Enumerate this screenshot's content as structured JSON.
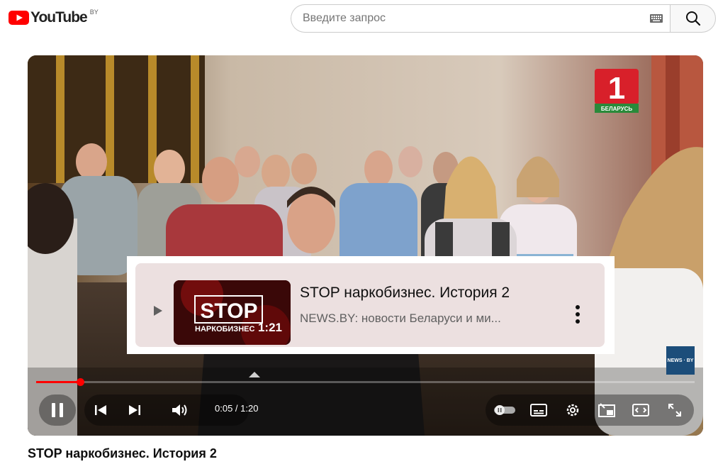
{
  "header": {
    "logo_text": "YouTube",
    "region": "BY",
    "search_placeholder": "Введите запрос",
    "icons": [
      "youtube-logo-icon",
      "keyboard-icon",
      "search-icon"
    ]
  },
  "player": {
    "channel_logo": {
      "digit": "1",
      "text": "БЕЛАРУСЬ"
    },
    "news_badge": "NEWS · BY",
    "card": {
      "title": "STOP наркобизнес. История 2",
      "channel": "NEWS.BY: новости Беларуси и ми...",
      "duration": "1:21",
      "thumb_text_big": "STOP",
      "thumb_text_small": "НАРКОБИЗНЕС"
    },
    "progress_fraction": 0.067,
    "time": "0:05 / 1:20",
    "controls": [
      "pause-icon",
      "previous-icon",
      "next-icon",
      "volume-icon",
      "autoplay-toggle",
      "subtitles-icon",
      "settings-icon",
      "miniplayer-icon",
      "theater-icon",
      "fullscreen-icon"
    ]
  },
  "video_title": "STOP наркобизнес. История 2",
  "colors": {
    "brand_red": "#ff0000",
    "card_bg": "#ece0e0",
    "badge_blue": "#1c4d7a"
  }
}
